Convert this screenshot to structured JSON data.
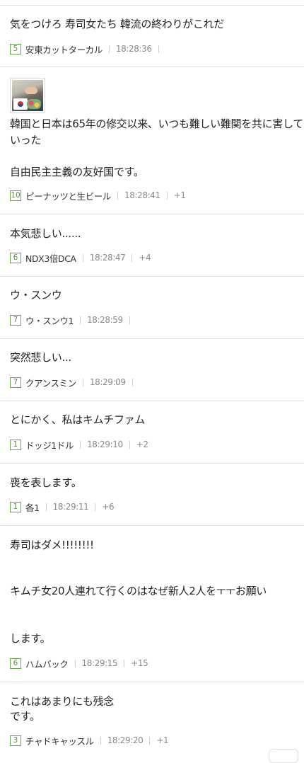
{
  "comments": [
    {
      "lines": [
        "気をつけろ 寿司女たち 韓流の終わりがこれだ"
      ],
      "votes": "5",
      "author": "安東カットターカル",
      "time": "18:28:36",
      "extra": ""
    },
    {
      "image_icon": "photo-thumbnail-icon",
      "lines": [
        "韓国と日本は65年の修交以来、いつも難しい難関を共に害して",
        "いった",
        "自由民主主義の友好国です。"
      ],
      "votes": "10",
      "author": "ピーナッツと生ビール",
      "time": "18:28:41",
      "extra": "+1"
    },
    {
      "lines": [
        "本気悲しい......"
      ],
      "votes": "6",
      "author": "NDX3倍DCA",
      "time": "18:28:47",
      "extra": "+4"
    },
    {
      "lines": [
        "ウ・スンウ"
      ],
      "votes": "7",
      "author": "ウ・スンウ1",
      "time": "18:28:59",
      "extra": ""
    },
    {
      "lines": [
        "突然悲しい..."
      ],
      "votes": "7",
      "author": "クアンスミン",
      "time": "18:29:09",
      "extra": ""
    },
    {
      "lines": [
        "とにかく、私はキムチファム"
      ],
      "votes": "1",
      "author": "ドッジ1ドル",
      "time": "18:29:10",
      "extra": "+2"
    },
    {
      "lines": [
        "喪を表します。"
      ],
      "votes": "1",
      "author": "各1",
      "time": "18:29:11",
      "extra": "+6"
    },
    {
      "lines": [
        "寿司はダメ!!!!!!!!",
        "キムチ女20人連れて行くのはなぜ新人2人をㅜㅜお願い",
        "します。"
      ],
      "votes": "6",
      "author": "ハムバック",
      "time": "18:29:15",
      "extra": "+15"
    },
    {
      "lines": [
        "これはあまりにも残念",
        "です。"
      ],
      "votes": "3",
      "author": "チャドキャッスル",
      "time": "18:29:20",
      "extra": "+1"
    }
  ]
}
